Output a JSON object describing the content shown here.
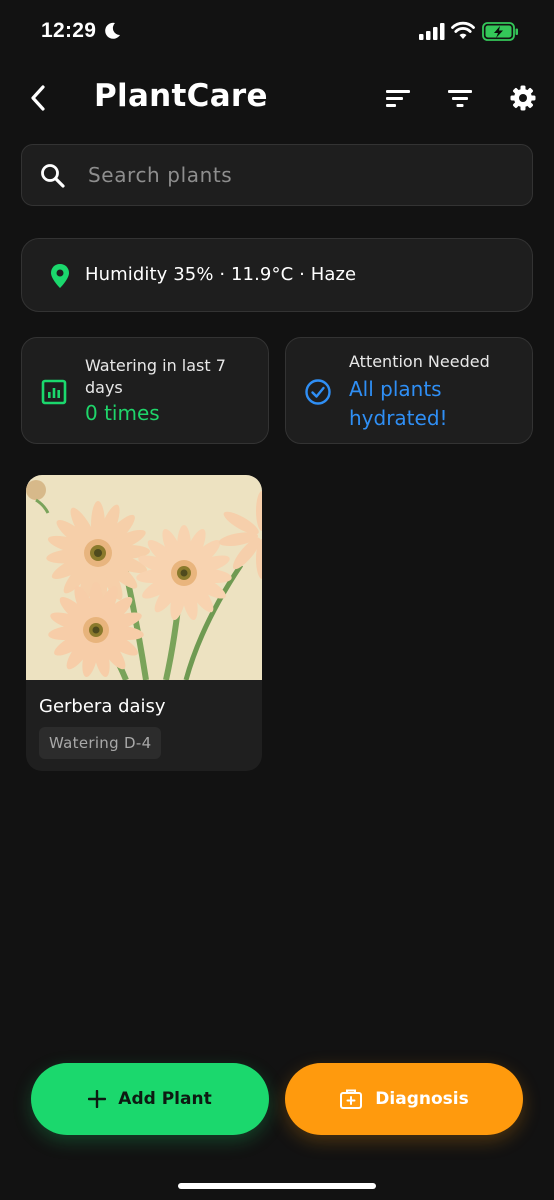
{
  "status_bar": {
    "time": "12:29",
    "icons": [
      "moon-icon",
      "signal-icon",
      "wifi-icon",
      "battery-charging-icon"
    ]
  },
  "header": {
    "title": "PlantCare",
    "icons": [
      "back-icon",
      "sort-icon",
      "filter-icon",
      "gear-icon"
    ]
  },
  "search": {
    "placeholder": "Search plants",
    "value": ""
  },
  "weather": {
    "icon": "location-pin-icon",
    "text": "Humidity 35% · 11.9°C · Haze"
  },
  "stats": {
    "watering": {
      "icon": "bar-chart-icon",
      "label": "Watering in last 7 days",
      "value": "0 times"
    },
    "attention": {
      "icon": "check-circle-icon",
      "label": "Attention Needed",
      "value": "All plants hydrated!"
    }
  },
  "plants": [
    {
      "name": "Gerbera daisy",
      "badge": "Watering D-4",
      "photo": "gerbera-daisy-photo"
    }
  ],
  "actions": {
    "add_label": "Add Plant",
    "diagnosis_label": "Diagnosis"
  },
  "colors": {
    "background": "#121212",
    "card": "#1e1e1e",
    "accent_green": "#1bd86d",
    "accent_orange": "#ff9a0d",
    "accent_blue": "#2f8ff5"
  }
}
